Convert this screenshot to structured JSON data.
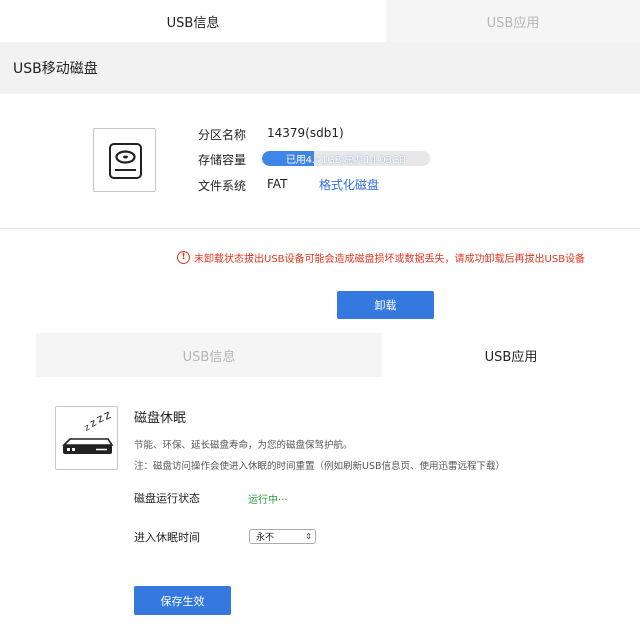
{
  "top_tabs": {
    "usb_info": "USB信息",
    "usb_app": "USB应用"
  },
  "section_title": "USB移动磁盘",
  "disk": {
    "partition_label": "分区名称",
    "partition_value": "14379(sdb1)",
    "capacity_label": "存储容量",
    "capacity_text": "已用4.41GB/总共14.03GB",
    "capacity_used_fraction": 0.31,
    "filesystem_label": "文件系统",
    "filesystem_value": "FAT",
    "format_link": "格式化磁盘"
  },
  "warning": {
    "icon": "!",
    "text": "未卸载状态拔出USB设备可能会造成磁盘损坏或数据丢失，请成功卸载后再拔出USB设备"
  },
  "unload_button": "卸载",
  "bottom_tabs": {
    "usb_info": "USB信息",
    "usb_app": "USB应用"
  },
  "sleep": {
    "title": "磁盘休眠",
    "desc": "节能、环保、延长磁盘寿命，为您的磁盘保驾护航。",
    "note": "注：磁盘访问操作会使进入休眠的时间重置（例如刷新USB信息页、使用迅雷远程下载）",
    "status_label": "磁盘运行状态",
    "status_value": "运行中···",
    "sleep_time_label": "进入休眠时间",
    "sleep_time_value": "永不",
    "save_button": "保存生效"
  },
  "colors": {
    "accent": "#3478e0",
    "link": "#2f6ee0",
    "warning": "#e3351f",
    "running": "#25a13c",
    "header_bg": "#f2f2f2"
  }
}
